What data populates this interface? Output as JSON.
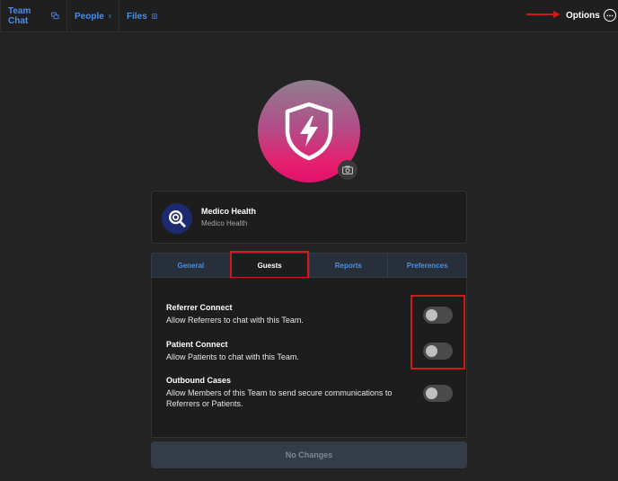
{
  "nav": {
    "team_chat": "Team Chat",
    "people": "People",
    "files": "Files"
  },
  "header": {
    "options_label": "Options"
  },
  "organization": {
    "name": "Medico Health",
    "subtitle": "Medico Health"
  },
  "tabs": [
    {
      "label": "General",
      "active": false
    },
    {
      "label": "Guests",
      "active": true
    },
    {
      "label": "Reports",
      "active": false
    },
    {
      "label": "Preferences",
      "active": false
    }
  ],
  "settings": [
    {
      "title": "Referrer Connect",
      "description": "Allow Referrers to chat with this Team.",
      "enabled": false
    },
    {
      "title": "Patient Connect",
      "description": "Allow Patients to chat with this Team.",
      "enabled": false
    },
    {
      "title": "Outbound Cases",
      "description": "Allow Members of this Team to send secure communications to Referrers or Patients.",
      "enabled": false
    }
  ],
  "footer": {
    "save_label": "No Changes"
  },
  "colors": {
    "accent": "#4c8fe6",
    "annotation": "#d21818",
    "background": "#232324",
    "avatar_gradient_end": "#e3106a"
  },
  "icons": {
    "team_chat": "chat-bubbles-icon",
    "people": "contact-card-icon",
    "files": "document-icon",
    "options": "more-dots-icon",
    "avatar": "shield-lightning-icon",
    "camera": "camera-icon",
    "org_logo": "magnifier-logo-icon"
  }
}
